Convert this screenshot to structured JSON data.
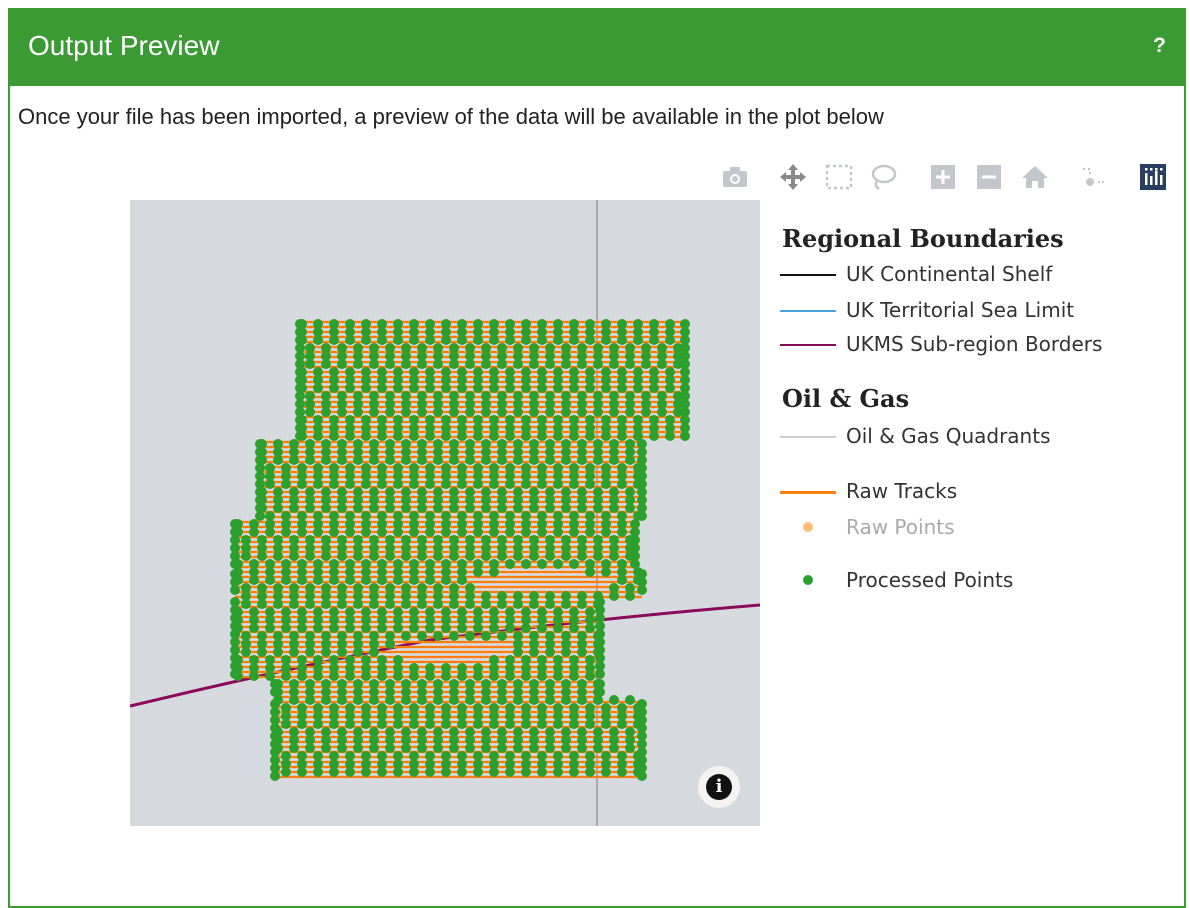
{
  "panel": {
    "title": "Output Preview",
    "help_label": "?",
    "intro_text": "Once your file has been imported, a preview of the data will be available in the plot below",
    "header_color": "#3c9a35"
  },
  "toolbar": {
    "icons": [
      "camera-icon",
      "pan-icon",
      "box-select-icon",
      "lasso-select-icon",
      "zoom-in-icon",
      "zoom-out-icon",
      "reset-axes-home-icon",
      "toggle-spike-lines-icon",
      "plotly-logo-icon"
    ]
  },
  "legend": {
    "group1_title": "Regional Boundaries",
    "group2_title": "Oil & Gas",
    "items": [
      {
        "label": "UK Continental Shelf",
        "color": "#111111"
      },
      {
        "label": "UK Territorial Sea Limit",
        "color": "#4aa3df"
      },
      {
        "label": "UKMS Sub-region Borders",
        "color": "#8a0a5a"
      },
      {
        "label": "Oil & Gas Quadrants",
        "color": "#cccccc"
      },
      {
        "label": "Raw Tracks",
        "color": "#ff7f0e"
      },
      {
        "label": "Raw Points",
        "color": "#ffbb78"
      },
      {
        "label": "Processed Points",
        "color": "#2ca02c"
      }
    ]
  },
  "map": {
    "background": "#d6dade",
    "info_label": "i"
  }
}
